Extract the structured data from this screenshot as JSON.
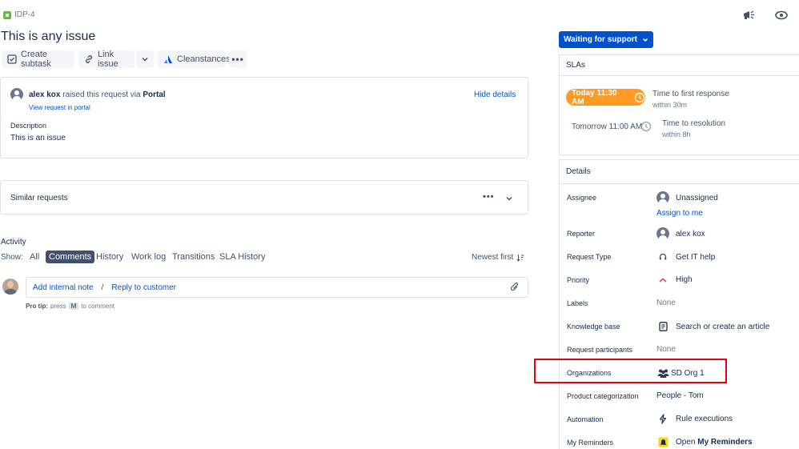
{
  "issue": {
    "key": "IDP-4",
    "title": "This is any issue"
  },
  "toolbar": {
    "create_subtask": "Create subtask",
    "link_issue": "Link issue",
    "cleanstances": "Cleanstances"
  },
  "request": {
    "reporter_name": "alex kox",
    "raised_text": "raised this request via",
    "portal": "Portal",
    "view_link": "View request in portal",
    "hide_details": "Hide details",
    "description_label": "Description",
    "description_text": "This is an issue"
  },
  "similar": {
    "title": "Similar requests"
  },
  "activity": {
    "title": "Activity",
    "show_label": "Show:",
    "tabs": [
      "All",
      "Comments",
      "History",
      "Work log",
      "Transitions",
      "SLA History"
    ],
    "active_tab": "Comments",
    "sort": "Newest first",
    "add_internal_note": "Add internal note",
    "separator": "/",
    "reply_to_customer": "Reply to customer",
    "pro_tip_label": "Pro tip:",
    "pro_tip_press": "press",
    "pro_tip_key": "M",
    "pro_tip_suffix": "to comment"
  },
  "status": {
    "label": "Waiting for support",
    "color": "#0052cc"
  },
  "slas": {
    "title": "SLAs",
    "items": [
      {
        "time": "Today 11:30 AM",
        "name": "Time to first response",
        "remaining": "within 30m",
        "color": "#ff991f"
      },
      {
        "time": "Tomorrow 11:00 AM",
        "name": "Time to resolution",
        "remaining": "within 8h"
      }
    ]
  },
  "details": {
    "title": "Details",
    "assignee_label": "Assignee",
    "assignee_value": "Unassigned",
    "assign_to_me": "Assign to me",
    "reporter_label": "Reporter",
    "reporter_value": "alex kox",
    "request_type_label": "Request Type",
    "request_type_value": "Get IT help",
    "priority_label": "Priority",
    "priority_value": "High",
    "labels_label": "Labels",
    "labels_value": "None",
    "kb_label": "Knowledge base",
    "kb_value": "Search or create an article",
    "participants_label": "Request participants",
    "participants_value": "None",
    "organizations_label": "Organizations",
    "organizations_value": "SD Org 1",
    "product_label": "Product categorization",
    "product_value": "People - Tom",
    "automation_label": "Automation",
    "automation_value": "Rule executions",
    "reminders_label": "My Reminders",
    "reminders_open": "Open",
    "reminders_bold": "My Reminders"
  },
  "colors": {
    "highlight": "#e3000f",
    "issue_type": "#65ba43",
    "priority_high": "#e5493a"
  }
}
